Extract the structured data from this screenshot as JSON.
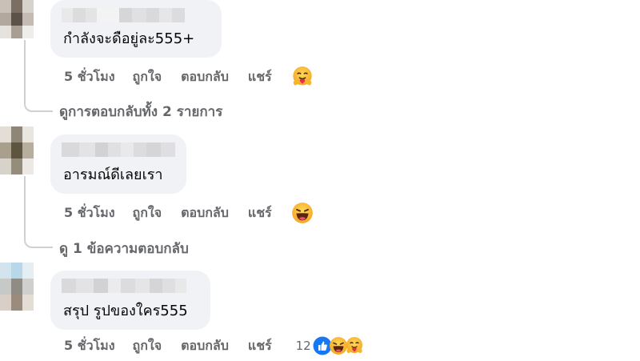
{
  "colors": {
    "bubble_bg": "#f0f2f5",
    "meta_text": "#65676b",
    "thread_line": "#ced0d4",
    "like_blue": "#1877f2"
  },
  "comments": [
    {
      "text": "กำลังจะดือยู่ละ555+",
      "time": "5 ชั่วโมง",
      "like_label": "ถูกใจ",
      "reply_label": "ตอบกลับ",
      "share_label": "แชร์",
      "reactions": [
        "hug-emoji"
      ],
      "replies_link": "ดูการตอบกลับทั้ง 2 รายการ"
    },
    {
      "text": "อารมณ์ดีเลยเรา",
      "time": "5 ชั่วโมง",
      "like_label": "ถูกใจ",
      "reply_label": "ตอบกลับ",
      "share_label": "แชร์",
      "reactions": [
        "haha-emoji"
      ],
      "replies_link": "ดู 1 ข้อความตอบกลับ"
    },
    {
      "text": "สรุป รูปของใคร555",
      "time": "5 ชั่วโมง",
      "like_label": "ถูกใจ",
      "reply_label": "ตอบกลับ",
      "share_label": "แชร์",
      "reaction_count": "12",
      "reactions": [
        "like-icon",
        "haha-emoji",
        "hug-emoji"
      ]
    }
  ]
}
